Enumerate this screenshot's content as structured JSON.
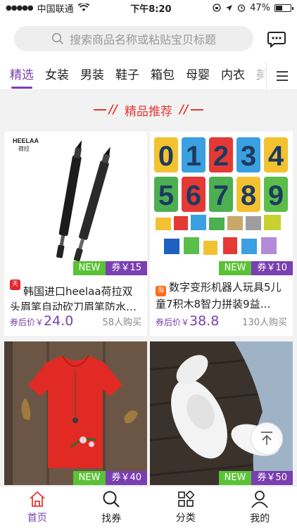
{
  "status_bar": {
    "carrier": "中国联通",
    "time": "下午8:20",
    "battery": "47%",
    "battery_level": 0.47
  },
  "search": {
    "placeholder": "搜索商品名称或粘贴宝贝标题"
  },
  "tabs": [
    {
      "label": "精选",
      "active": true
    },
    {
      "label": "女装"
    },
    {
      "label": "男装"
    },
    {
      "label": "鞋子"
    },
    {
      "label": "箱包"
    },
    {
      "label": "母婴"
    },
    {
      "label": "内衣"
    },
    {
      "label": "美"
    }
  ],
  "section_title": "精品推荐",
  "products": [
    {
      "image_text": "HEELAA",
      "image_subtext": "荷拉",
      "new_label": "NEW",
      "coupon": "券￥15",
      "shop_icon": "tmall-icon",
      "shop_icon_text": "天猫",
      "title": "韩国进口heelaa荷拉双头眉笔自动砍刀眉笔防水…",
      "price_label": "券后价￥",
      "price": "24.0",
      "sold": "58人购买"
    },
    {
      "image_digits": [
        "0",
        "1",
        "2",
        "3",
        "4",
        "5",
        "6",
        "7",
        "8",
        "9"
      ],
      "new_label": "NEW",
      "coupon": "券￥10",
      "shop_icon": "taobao-icon",
      "shop_icon_text": "淘",
      "title": "数字变形机器人玩具5儿童7积木8智力拼装9益…",
      "price_label": "券后价￥",
      "price": "38.8",
      "sold": "130人购买"
    },
    {
      "new_label": "NEW",
      "coupon": "券￥40"
    },
    {
      "new_label": "NEW",
      "coupon": "券￥50"
    }
  ],
  "nav": [
    {
      "label": "首页",
      "icon": "home-icon",
      "active": true
    },
    {
      "label": "找券",
      "icon": "search-icon"
    },
    {
      "label": "分类",
      "icon": "category-icon"
    },
    {
      "label": "我的",
      "icon": "user-icon"
    }
  ],
  "colors": {
    "accent": "#7a3fb0",
    "section": "#e53935",
    "new_badge": "#5bc236"
  }
}
